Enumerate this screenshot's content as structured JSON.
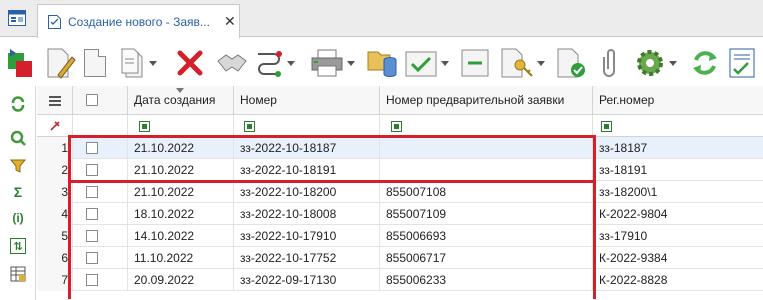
{
  "tab": {
    "title": "Создание нового - Заяв...",
    "close": "✕"
  },
  "columns": [
    "Дата создания",
    "Номер",
    "Номер предварительной заявки",
    "Рег.номер"
  ],
  "rows": [
    {
      "n": "1",
      "date": "21.10.2022",
      "number": "зз-2022-10-18187",
      "pre": "",
      "reg": "зз-18187"
    },
    {
      "n": "2",
      "date": "21.10.2022",
      "number": "зз-2022-10-18191",
      "pre": "",
      "reg": "зз-18191"
    },
    {
      "n": "3",
      "date": "21.10.2022",
      "number": "зз-2022-10-18200",
      "pre": "855007108",
      "reg": "зз-18200\\1"
    },
    {
      "n": "4",
      "date": "18.10.2022",
      "number": "зз-2022-10-18008",
      "pre": "855007109",
      "reg": "К-2022-9804"
    },
    {
      "n": "5",
      "date": "14.10.2022",
      "number": "зз-2022-10-17910",
      "pre": "855006693",
      "reg": "зз-17910"
    },
    {
      "n": "6",
      "date": "11.10.2022",
      "number": "зз-2022-10-17752",
      "pre": "855006717",
      "reg": "К-2022-9384"
    },
    {
      "n": "7",
      "date": "20.09.2022",
      "number": "зз-2022-09-17130",
      "pre": "855006233",
      "reg": "К-2022-8828"
    }
  ],
  "sidebar_symbols": {
    "sum": "Σ",
    "info": "(i)",
    "sort": "⇅"
  },
  "colors": {
    "highlight": "#d5202c",
    "accent": "#2b5fa6",
    "selected_row": "#e8f1fb"
  },
  "icons": [
    "app-icon",
    "doc-icon",
    "refresh-icon",
    "search-icon",
    "filter-icon",
    "sum-icon",
    "info-icon",
    "sort-icon",
    "table-icon"
  ]
}
